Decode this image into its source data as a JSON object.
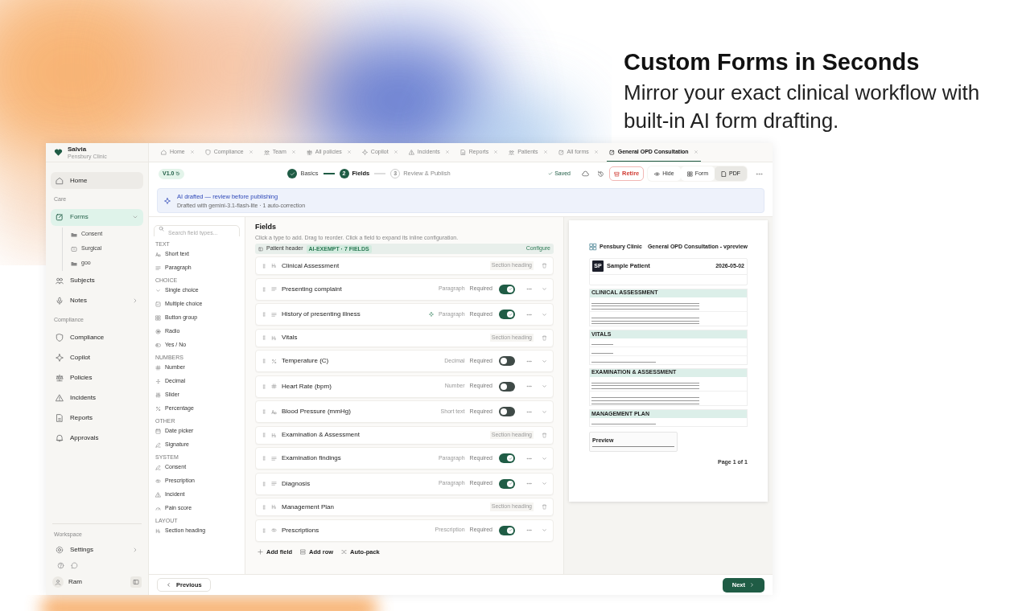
{
  "hero": {
    "title": "Custom Forms in Seconds",
    "subtitle": "Mirror your exact clinical workflow with built-in AI form drafting."
  },
  "sidebar": {
    "brand": "Salvia",
    "org": "Pensbury Clinic",
    "nav": [
      {
        "kind": "item",
        "label": "Home",
        "selected": false,
        "hovered": true
      },
      {
        "kind": "section",
        "label": "Care"
      },
      {
        "kind": "item",
        "label": "Forms",
        "selected": true,
        "hovered": false,
        "expanded": true,
        "children": [
          {
            "label": "Consent"
          },
          {
            "label": "Surgical"
          },
          {
            "label": "goo"
          }
        ]
      },
      {
        "kind": "item",
        "label": "Subjects",
        "selected": false,
        "hovered": false
      },
      {
        "kind": "item",
        "label": "Notes",
        "selected": false,
        "hovered": false,
        "expanded": false
      },
      {
        "kind": "section",
        "label": "Compliance"
      },
      {
        "kind": "item",
        "label": "Compliance",
        "selected": false,
        "hovered": false
      },
      {
        "kind": "item",
        "label": "Copilot",
        "selected": false,
        "hovered": false
      },
      {
        "kind": "item",
        "label": "Policies",
        "selected": false,
        "hovered": false
      },
      {
        "kind": "item",
        "label": "Incidents",
        "selected": false,
        "hovered": false
      },
      {
        "kind": "item",
        "label": "Reports",
        "selected": false,
        "hovered": false
      },
      {
        "kind": "item",
        "label": "Approvals",
        "selected": false,
        "hovered": false
      }
    ],
    "workspace": "Workspace",
    "settings": {
      "label": "Settings",
      "expanded": false
    },
    "user": "Ram"
  },
  "tabs": [
    {
      "label": "Home",
      "selected": false
    },
    {
      "label": "Compliance",
      "selected": false
    },
    {
      "label": "Team",
      "selected": false
    },
    {
      "label": "All policies",
      "selected": false
    },
    {
      "label": "Copilot",
      "selected": false
    },
    {
      "label": "Incidents",
      "selected": false
    },
    {
      "label": "Reports",
      "selected": false
    },
    {
      "label": "Patients",
      "selected": false
    },
    {
      "label": "All forms",
      "selected": false
    },
    {
      "label": "General OPD Consultation",
      "selected": true
    }
  ],
  "toolbar": {
    "version": "V1.0",
    "steps": [
      {
        "label": "Basics",
        "completed": true,
        "selected": false
      },
      {
        "number": "2",
        "label": "Fields",
        "completed": false,
        "selected": true
      },
      {
        "number": "3",
        "label": "Review & Publish",
        "completed": false,
        "selected": false
      }
    ],
    "saved": "Saved",
    "retire": "Retire",
    "views": [
      {
        "label": "Hide",
        "selected": false
      },
      {
        "label": "Form",
        "selected": false
      },
      {
        "label": "PDF",
        "selected": true
      }
    ]
  },
  "banner": {
    "title": "AI drafted — review before publishing",
    "detail": "Drafted with gemini-3.1-flash-lite · 1 auto-correction"
  },
  "palette": {
    "placeholder": "Search field types...",
    "groups": [
      {
        "label": "TEXT",
        "items": [
          "Short text",
          "Paragraph"
        ]
      },
      {
        "label": "CHOICE",
        "items": [
          "Single choice",
          "Multiple choice",
          "Button group",
          "Radio",
          "Yes / No"
        ]
      },
      {
        "label": "NUMBERS",
        "items": [
          "Number",
          "Decimal",
          "Slider",
          "Percentage"
        ]
      },
      {
        "label": "OTHER",
        "items": [
          "Date picker",
          "Signature"
        ]
      },
      {
        "label": "SYSTEM",
        "items": [
          "Consent",
          "Prescription",
          "Incident",
          "Pain score"
        ]
      },
      {
        "label": "LAYOUT",
        "items": [
          "Section heading"
        ]
      }
    ]
  },
  "fields": {
    "title": "Fields",
    "hint": "Click a type to add. Drag to reorder. Click a field to expand its inline configuration.",
    "patient_header": {
      "label": "Patient header",
      "badge": "AI-EXEMPT · 7 FIELDS",
      "action": "Configure"
    },
    "rows": [
      {
        "kind": "heading",
        "label": "Clinical Assessment",
        "type": "Section heading"
      },
      {
        "kind": "field",
        "label": "Presenting complaint",
        "type": "Paragraph",
        "required_label": "Required",
        "required": true,
        "ai": false
      },
      {
        "kind": "field",
        "label": "History of presenting illness",
        "type": "Paragraph",
        "required_label": "Required",
        "required": true,
        "ai": true
      },
      {
        "kind": "heading",
        "label": "Vitals",
        "type": "Section heading"
      },
      {
        "kind": "field",
        "label": "Temperature (C)",
        "type": "Decimal",
        "required_label": "Required",
        "required": false,
        "ai": false
      },
      {
        "kind": "field",
        "label": "Heart Rate (bpm)",
        "type": "Number",
        "required_label": "Required",
        "required": false,
        "ai": false
      },
      {
        "kind": "field",
        "label": "Blood Pressure (mmHg)",
        "type": "Short text",
        "required_label": "Required",
        "required": false,
        "ai": false
      },
      {
        "kind": "heading",
        "label": "Examination & Assessment",
        "type": "Section heading"
      },
      {
        "kind": "field",
        "label": "Examination findings",
        "type": "Paragraph",
        "required_label": "Required",
        "required": true,
        "ai": false
      },
      {
        "kind": "field",
        "label": "Diagnosis",
        "type": "Paragraph",
        "required_label": "Required",
        "required": true,
        "ai": false
      },
      {
        "kind": "heading",
        "label": "Management Plan",
        "type": "Section heading"
      },
      {
        "kind": "field",
        "label": "Prescriptions",
        "type": "Prescription",
        "required_label": "Required",
        "required": true,
        "ai": false
      }
    ],
    "actions": [
      "Add field",
      "Add row",
      "Auto-pack"
    ]
  },
  "preview": {
    "clinic": "Pensbury Clinic",
    "title": "General OPD Consultation - vpreview",
    "patient": {
      "initials": "SP",
      "name": "Sample Patient",
      "encounter": "2026-05-02"
    },
    "sections": [
      {
        "title": "CLINICAL ASSESSMENT",
        "fields": [
          {
            "kind": "long"
          },
          {
            "kind": "long"
          }
        ]
      },
      {
        "title": "VITALS",
        "fields": [
          {
            "kind": "short"
          },
          {
            "kind": "short"
          },
          {
            "kind": "medium"
          }
        ]
      },
      {
        "title": "EXAMINATION & ASSESSMENT",
        "fields": [
          {
            "kind": "long"
          },
          {
            "kind": "long"
          }
        ]
      },
      {
        "title": "MANAGEMENT PLAN",
        "fields": [
          {
            "kind": "medium"
          }
        ]
      }
    ],
    "signature": {
      "name": "Preview"
    },
    "footer": {
      "page": "Page 1 of 1"
    }
  },
  "nav_buttons": {
    "previous": "Previous",
    "next": "Next"
  }
}
